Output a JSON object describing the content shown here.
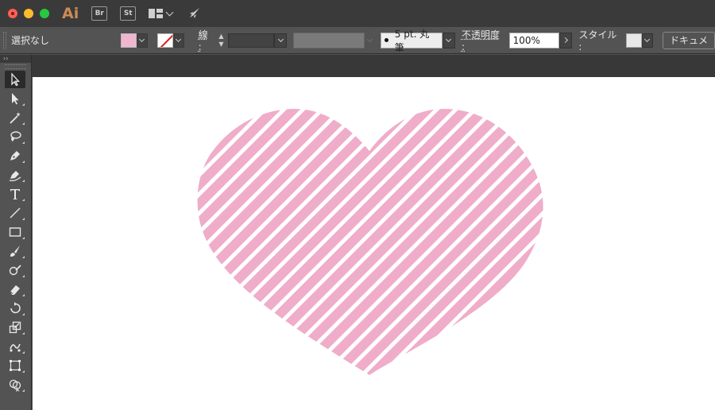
{
  "titlebar": {
    "app_logo": "Ai",
    "bridge_label": "Br",
    "stock_label": "St"
  },
  "control": {
    "selection_status": "選択なし",
    "stroke_label": "線 :",
    "brush_name": "5 pt. 丸筆",
    "opacity_label": "不透明度 :",
    "opacity_value": "100%",
    "style_label": "スタイル :",
    "document_button": "ドキュメ"
  },
  "tools_header": "››",
  "colors": {
    "fill": "#f0b6d0",
    "heart": "#efadc9",
    "stroke_none_slash": "#e2191a",
    "app_logo": "#cc8a56"
  }
}
